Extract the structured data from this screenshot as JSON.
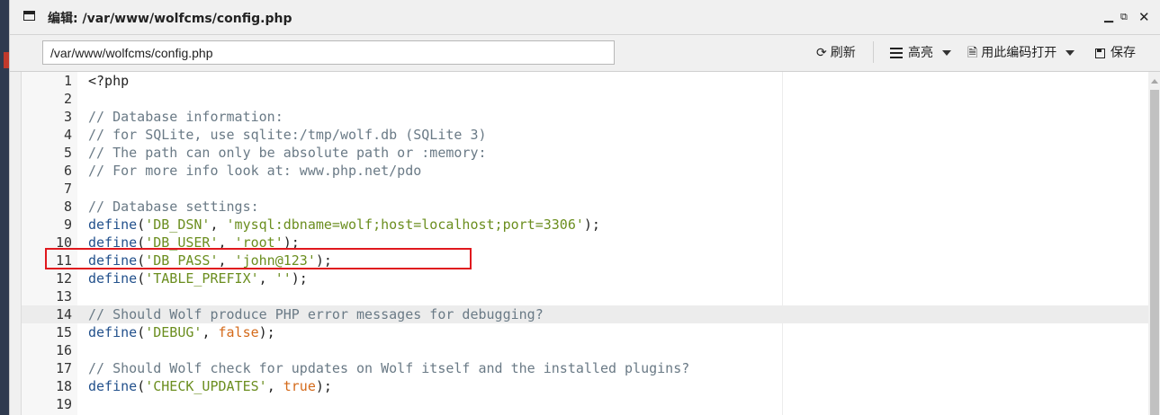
{
  "window": {
    "title": "编辑: /var/www/wolfcms/config.php"
  },
  "toolbar": {
    "path_value": "/var/www/wolfcms/config.php",
    "refresh_label": "刷新",
    "highlight_label": "高亮",
    "open_with_encoding_label": "用此编码打开",
    "save_label": "保存"
  },
  "colors": {
    "comment": "#6a7a86",
    "function": "#23518c",
    "string": "#6b8e1f",
    "boolean": "#d46a1a",
    "annotation_box": "#e0181e"
  },
  "editor": {
    "active_line": 14,
    "highlighted_line": 11,
    "lines": [
      {
        "n": "1",
        "tokens": [
          {
            "t": "plain",
            "v": "<?php"
          }
        ]
      },
      {
        "n": "2",
        "tokens": []
      },
      {
        "n": "3",
        "tokens": [
          {
            "t": "comment",
            "v": "// Database information:"
          }
        ]
      },
      {
        "n": "4",
        "tokens": [
          {
            "t": "comment",
            "v": "// for SQLite, use sqlite:/tmp/wolf.db (SQLite 3)"
          }
        ]
      },
      {
        "n": "5",
        "tokens": [
          {
            "t": "comment",
            "v": "// The path can only be absolute path or :memory:"
          }
        ]
      },
      {
        "n": "6",
        "tokens": [
          {
            "t": "comment",
            "v": "// For more info look at: www.php.net/pdo"
          }
        ]
      },
      {
        "n": "7",
        "tokens": []
      },
      {
        "n": "8",
        "tokens": [
          {
            "t": "comment",
            "v": "// Database settings:"
          }
        ]
      },
      {
        "n": "9",
        "tokens": [
          {
            "t": "func",
            "v": "define"
          },
          {
            "t": "punc",
            "v": "("
          },
          {
            "t": "string",
            "v": "'DB_DSN'"
          },
          {
            "t": "punc",
            "v": ", "
          },
          {
            "t": "string",
            "v": "'mysql:dbname=wolf;host=localhost;port=3306'"
          },
          {
            "t": "punc",
            "v": ");"
          }
        ]
      },
      {
        "n": "10",
        "tokens": [
          {
            "t": "func",
            "v": "define"
          },
          {
            "t": "punc",
            "v": "("
          },
          {
            "t": "string",
            "v": "'DB_USER'"
          },
          {
            "t": "punc",
            "v": ", "
          },
          {
            "t": "string",
            "v": "'root'"
          },
          {
            "t": "punc",
            "v": ");"
          }
        ]
      },
      {
        "n": "11",
        "tokens": [
          {
            "t": "func",
            "v": "define"
          },
          {
            "t": "punc",
            "v": "("
          },
          {
            "t": "string",
            "v": "'DB_PASS'"
          },
          {
            "t": "punc",
            "v": ", "
          },
          {
            "t": "string",
            "v": "'john@123'"
          },
          {
            "t": "punc",
            "v": ");"
          }
        ]
      },
      {
        "n": "12",
        "tokens": [
          {
            "t": "func",
            "v": "define"
          },
          {
            "t": "punc",
            "v": "("
          },
          {
            "t": "string",
            "v": "'TABLE_PREFIX'"
          },
          {
            "t": "punc",
            "v": ", "
          },
          {
            "t": "string",
            "v": "''"
          },
          {
            "t": "punc",
            "v": ");"
          }
        ]
      },
      {
        "n": "13",
        "tokens": []
      },
      {
        "n": "14",
        "tokens": [
          {
            "t": "comment",
            "v": "// Should Wolf produce PHP error messages for debugging?"
          }
        ]
      },
      {
        "n": "15",
        "tokens": [
          {
            "t": "func",
            "v": "define"
          },
          {
            "t": "punc",
            "v": "("
          },
          {
            "t": "string",
            "v": "'DEBUG'"
          },
          {
            "t": "punc",
            "v": ", "
          },
          {
            "t": "bool",
            "v": "false"
          },
          {
            "t": "punc",
            "v": ");"
          }
        ]
      },
      {
        "n": "16",
        "tokens": []
      },
      {
        "n": "17",
        "tokens": [
          {
            "t": "comment",
            "v": "// Should Wolf check for updates on Wolf itself and the installed plugins?"
          }
        ]
      },
      {
        "n": "18",
        "tokens": [
          {
            "t": "func",
            "v": "define"
          },
          {
            "t": "punc",
            "v": "("
          },
          {
            "t": "string",
            "v": "'CHECK_UPDATES'"
          },
          {
            "t": "punc",
            "v": ", "
          },
          {
            "t": "bool",
            "v": "true"
          },
          {
            "t": "punc",
            "v": ");"
          }
        ]
      },
      {
        "n": "19",
        "tokens": []
      }
    ]
  }
}
